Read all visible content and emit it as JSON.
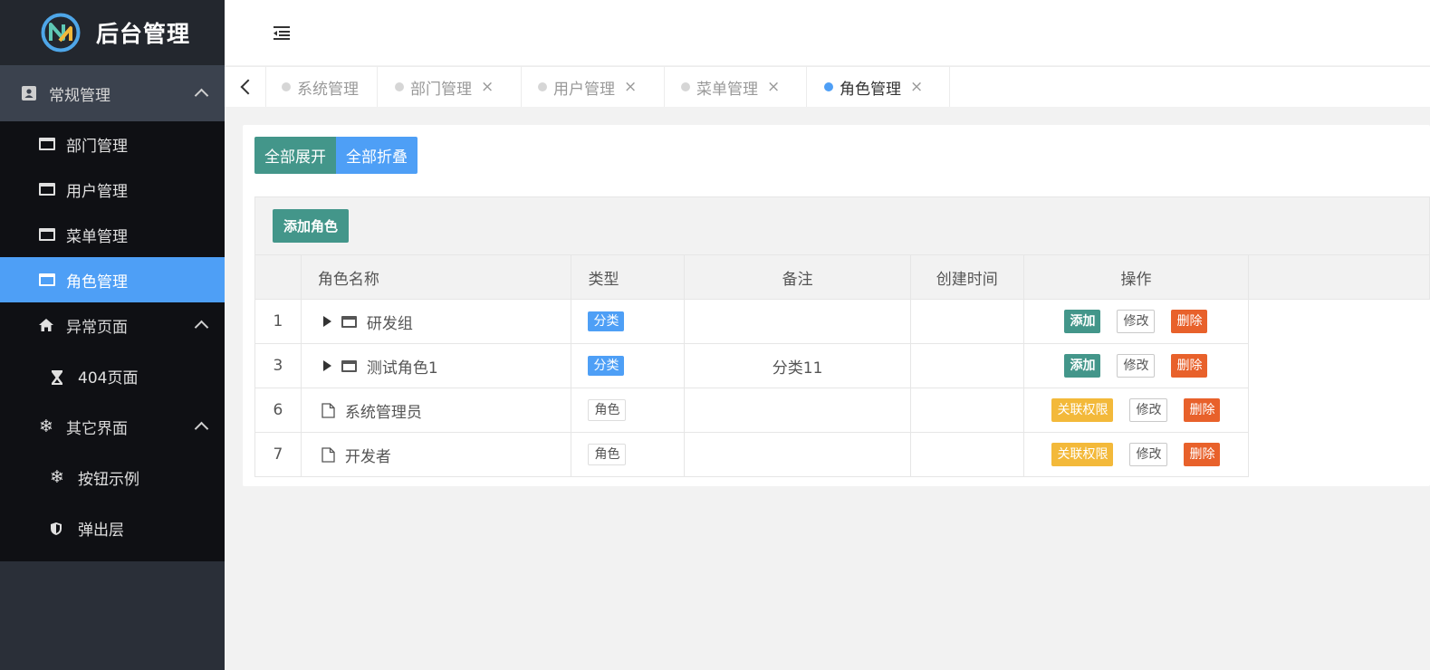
{
  "app": {
    "title": "后台管理"
  },
  "sidebar": {
    "groups": [
      {
        "label": "常规管理",
        "icon": "contact-card-icon"
      },
      {
        "label": "异常页面",
        "icon": "home-icon"
      },
      {
        "label": "其它界面",
        "icon": "snowflake-icon"
      }
    ],
    "items": [
      {
        "label": "部门管理"
      },
      {
        "label": "用户管理"
      },
      {
        "label": "菜单管理"
      },
      {
        "label": "角色管理",
        "active": true
      },
      {
        "label": "404页面",
        "icon": "hourglass-icon"
      },
      {
        "label": "按钮示例",
        "icon": "snowflake-icon"
      },
      {
        "label": "弹出层",
        "icon": "shield-icon"
      }
    ]
  },
  "tabs": [
    {
      "label": "系统管理",
      "close": ""
    },
    {
      "label": "部门管理",
      "close": "×"
    },
    {
      "label": "用户管理",
      "close": "×"
    },
    {
      "label": "菜单管理",
      "close": "×"
    },
    {
      "label": "角色管理",
      "close": "×",
      "active": true
    }
  ],
  "buttons": {
    "expand_all": "全部展开",
    "collapse_all": "全部折叠",
    "add_role": "添加角色"
  },
  "table": {
    "columns": [
      "",
      "角色名称",
      "类型",
      "备注",
      "创建时间",
      "操作"
    ],
    "rows": [
      {
        "id": "1",
        "name": "研发组",
        "type": "分类",
        "remark": "",
        "created": "",
        "ops": [
          "添加",
          "修改",
          "删除"
        ]
      },
      {
        "id": "3",
        "name": "测试角色1",
        "type": "分类",
        "remark": "分类11",
        "created": "",
        "ops": [
          "添加",
          "修改",
          "删除"
        ]
      },
      {
        "id": "6",
        "name": "系统管理员",
        "type": "角色",
        "remark": "",
        "created": "",
        "ops": [
          "关联权限",
          "修改",
          "删除"
        ]
      },
      {
        "id": "7",
        "name": "开发者",
        "type": "角色",
        "remark": "",
        "created": "",
        "ops": [
          "关联权限",
          "修改",
          "删除"
        ]
      }
    ]
  },
  "colors": {
    "accent": "#4e9ff6",
    "green": "#43968a",
    "red": "#e8612b",
    "yellow": "#f3b93a",
    "sidebar": "#2a2f38"
  }
}
